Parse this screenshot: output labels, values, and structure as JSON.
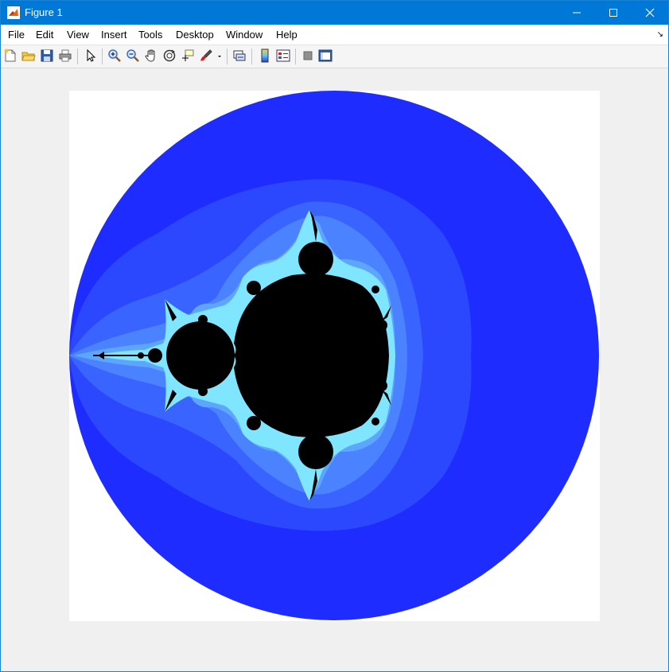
{
  "window": {
    "title": "Figure 1"
  },
  "menu": {
    "items": [
      "File",
      "Edit",
      "View",
      "Insert",
      "Tools",
      "Desktop",
      "Window",
      "Help"
    ]
  },
  "toolbar": {
    "icons": [
      "new-figure-icon",
      "open-file-icon",
      "save-icon",
      "print-icon",
      "pointer-icon",
      "zoom-in-icon",
      "zoom-out-icon",
      "pan-icon",
      "rotate-3d-icon",
      "data-cursor-icon",
      "brush-icon",
      "link-plot-icon",
      "colorbar-icon",
      "legend-icon",
      "hide-plot-tools-icon",
      "show-plot-tools-icon"
    ]
  },
  "figure": {
    "image": "mandelbrot-set",
    "colors": {
      "outer": "#1e2cff",
      "band1": "#2b48ff",
      "band2": "#3a64ff",
      "band3": "#4b82ff",
      "band4": "#5da6ff",
      "edge": "#80e6ff",
      "set": "#000000"
    }
  }
}
